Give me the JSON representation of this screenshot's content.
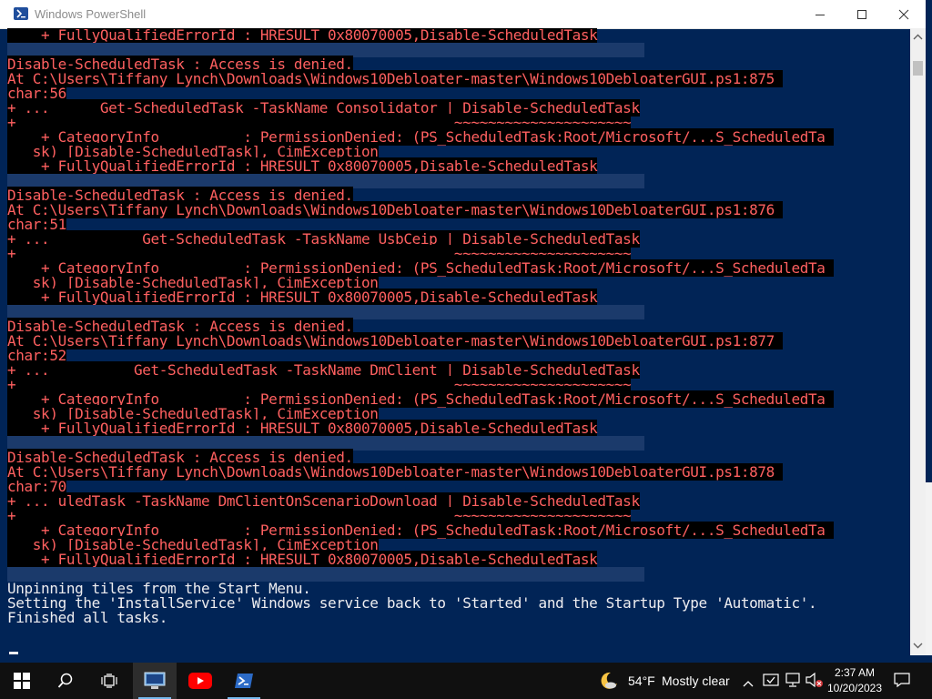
{
  "window": {
    "title": "Windows PowerShell"
  },
  "console": {
    "lines": [
      {
        "text": "    + FullyQualifiedErrorId : HRESULT 0x80070005,Disable-ScheduledTask",
        "style": "err"
      },
      {
        "text": "",
        "style": "blank"
      },
      {
        "text": "Disable-ScheduledTask : Access is denied.",
        "style": "err"
      },
      {
        "text": "At C:\\Users\\Tiffany Lynch\\Downloads\\Windows10Debloater-master\\Windows10DebloaterGUI.ps1:875 ",
        "style": "err"
      },
      {
        "text": "char:56",
        "style": "err"
      },
      {
        "text": "+ ...      Get-ScheduledTask -TaskName Consolidator | Disable-ScheduledTask",
        "style": "err"
      },
      {
        "text": "+                                                    ~~~~~~~~~~~~~~~~~~~~~",
        "style": "err"
      },
      {
        "text": "    + CategoryInfo          : PermissionDenied: (PS_ScheduledTask:Root/Microsoft/...S_ScheduledTa ",
        "style": "err"
      },
      {
        "text": "   sk) [Disable-ScheduledTask], CimException",
        "style": "err"
      },
      {
        "text": "    + FullyQualifiedErrorId : HRESULT 0x80070005,Disable-ScheduledTask",
        "style": "err"
      },
      {
        "text": "",
        "style": "blank"
      },
      {
        "text": "Disable-ScheduledTask : Access is denied.",
        "style": "err"
      },
      {
        "text": "At C:\\Users\\Tiffany Lynch\\Downloads\\Windows10Debloater-master\\Windows10DebloaterGUI.ps1:876 ",
        "style": "err"
      },
      {
        "text": "char:51",
        "style": "err"
      },
      {
        "text": "+ ...           Get-ScheduledTask -TaskName UsbCeip | Disable-ScheduledTask",
        "style": "err"
      },
      {
        "text": "+                                                    ~~~~~~~~~~~~~~~~~~~~~",
        "style": "err"
      },
      {
        "text": "    + CategoryInfo          : PermissionDenied: (PS_ScheduledTask:Root/Microsoft/...S_ScheduledTa ",
        "style": "err"
      },
      {
        "text": "   sk) [Disable-ScheduledTask], CimException",
        "style": "err"
      },
      {
        "text": "    + FullyQualifiedErrorId : HRESULT 0x80070005,Disable-ScheduledTask",
        "style": "err"
      },
      {
        "text": "",
        "style": "blank"
      },
      {
        "text": "Disable-ScheduledTask : Access is denied.",
        "style": "err"
      },
      {
        "text": "At C:\\Users\\Tiffany Lynch\\Downloads\\Windows10Debloater-master\\Windows10DebloaterGUI.ps1:877 ",
        "style": "err"
      },
      {
        "text": "char:52",
        "style": "err"
      },
      {
        "text": "+ ...          Get-ScheduledTask -TaskName DmClient | Disable-ScheduledTask",
        "style": "err"
      },
      {
        "text": "+                                                    ~~~~~~~~~~~~~~~~~~~~~",
        "style": "err"
      },
      {
        "text": "    + CategoryInfo          : PermissionDenied: (PS_ScheduledTask:Root/Microsoft/...S_ScheduledTa ",
        "style": "err"
      },
      {
        "text": "   sk) [Disable-ScheduledTask], CimException",
        "style": "err"
      },
      {
        "text": "    + FullyQualifiedErrorId : HRESULT 0x80070005,Disable-ScheduledTask",
        "style": "err"
      },
      {
        "text": "",
        "style": "blank"
      },
      {
        "text": "Disable-ScheduledTask : Access is denied.",
        "style": "err"
      },
      {
        "text": "At C:\\Users\\Tiffany Lynch\\Downloads\\Windows10Debloater-master\\Windows10DebloaterGUI.ps1:878 ",
        "style": "err"
      },
      {
        "text": "char:70",
        "style": "err"
      },
      {
        "text": "+ ... uledTask -TaskName DmClientOnScenarioDownload | Disable-ScheduledTask",
        "style": "err"
      },
      {
        "text": "+                                                    ~~~~~~~~~~~~~~~~~~~~~",
        "style": "err"
      },
      {
        "text": "    + CategoryInfo          : PermissionDenied: (PS_ScheduledTask:Root/Microsoft/...S_ScheduledTa ",
        "style": "err"
      },
      {
        "text": "   sk) [Disable-ScheduledTask], CimException",
        "style": "err"
      },
      {
        "text": "    + FullyQualifiedErrorId : HRESULT 0x80070005,Disable-ScheduledTask",
        "style": "err"
      },
      {
        "text": "",
        "style": "blank"
      },
      {
        "text": "Unpinning tiles from the Start Menu.",
        "style": "norm"
      },
      {
        "text": "Setting the 'InstallService' Windows service back to 'Started' and the Startup Type 'Automatic'.",
        "style": "norm"
      },
      {
        "text": "Finished all tasks.",
        "style": "norm"
      }
    ]
  },
  "taskbar": {
    "pinned": [
      {
        "name": "start-button",
        "icon": "windows-logo-icon"
      },
      {
        "name": "search-button",
        "icon": "search-icon"
      },
      {
        "name": "task-view-button",
        "icon": "task-view-icon"
      },
      {
        "name": "taskbar-app-computer",
        "icon": "computer-icon"
      },
      {
        "name": "taskbar-app-youtube",
        "icon": "youtube-icon"
      },
      {
        "name": "taskbar-app-powershell",
        "icon": "powershell-icon"
      }
    ],
    "weather": {
      "temp": "54°F",
      "condition": "Mostly clear"
    },
    "clock": {
      "time": "2:37 AM",
      "date": "10/20/2023"
    }
  },
  "colors": {
    "console_bg": "#012456",
    "error_fg": "#ff6060",
    "error_bg": "#000000",
    "normal_fg": "#eeedf0",
    "taskbar_bg": "#101010",
    "accent": "#76b9ed"
  }
}
